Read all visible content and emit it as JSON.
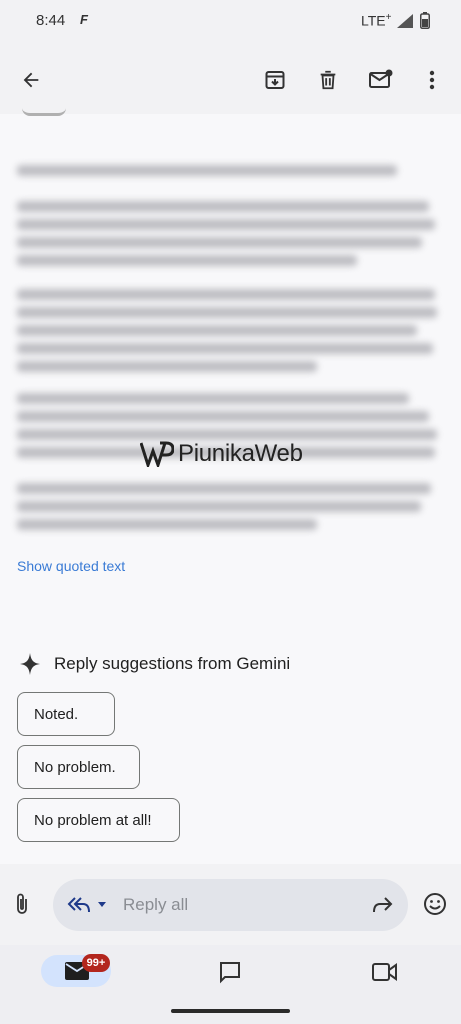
{
  "status_bar": {
    "time": "8:44",
    "network": "LTE",
    "network_suffix": "+"
  },
  "email": {
    "watermark": "PiunikaWeb",
    "show_quoted_text": "Show quoted text"
  },
  "gemini": {
    "title": "Reply suggestions from Gemini",
    "suggestions": [
      "Noted.",
      "No problem.",
      "No problem at all!"
    ]
  },
  "reply_bar": {
    "placeholder": "Reply all"
  },
  "bottom_nav": {
    "mail_badge": "99+"
  },
  "colors": {
    "accent": "#3a7bd5",
    "badge": "#b3261e",
    "nav_pill": "#d3e3fd"
  }
}
